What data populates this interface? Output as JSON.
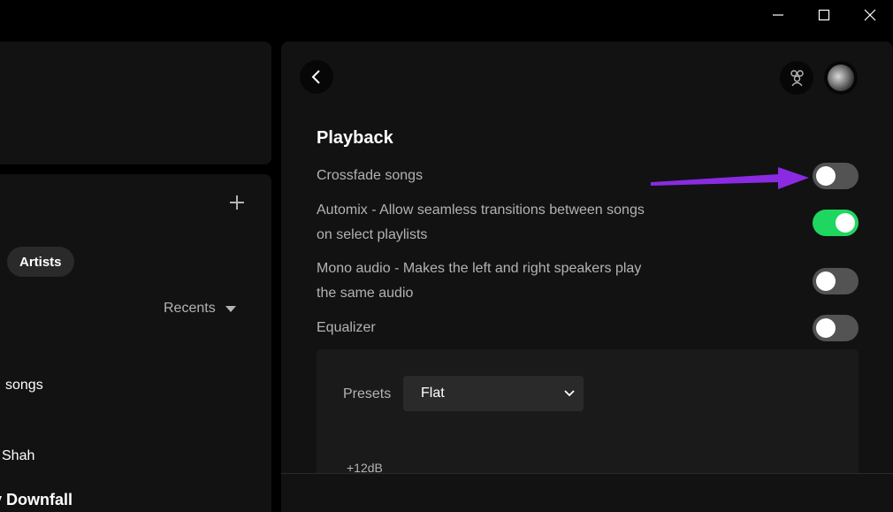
{
  "window_controls": {
    "minimize": "—",
    "maximize": "☐",
    "close": "✕"
  },
  "library": {
    "filter_chip": "Artists",
    "sort_label": "Recents",
    "items": [
      "songs",
      "Shah",
      "Downfall"
    ]
  },
  "settings": {
    "section_title": "Playback",
    "crossfade": {
      "label": "Crossfade songs",
      "enabled": false
    },
    "automix": {
      "label": "Automix - Allow seamless transitions between songs on select playlists",
      "enabled": true
    },
    "mono": {
      "label": "Mono audio - Makes the left and right speakers play the same audio",
      "enabled": false
    },
    "equalizer": {
      "label": "Equalizer",
      "enabled": false
    },
    "presets_label": "Presets",
    "preset_value": "Flat",
    "eq_partial_label": "+12dB"
  },
  "colors": {
    "toggle_on": "#1ed760",
    "toggle_off": "#535353",
    "annotation_arrow": "#8a2be2"
  }
}
